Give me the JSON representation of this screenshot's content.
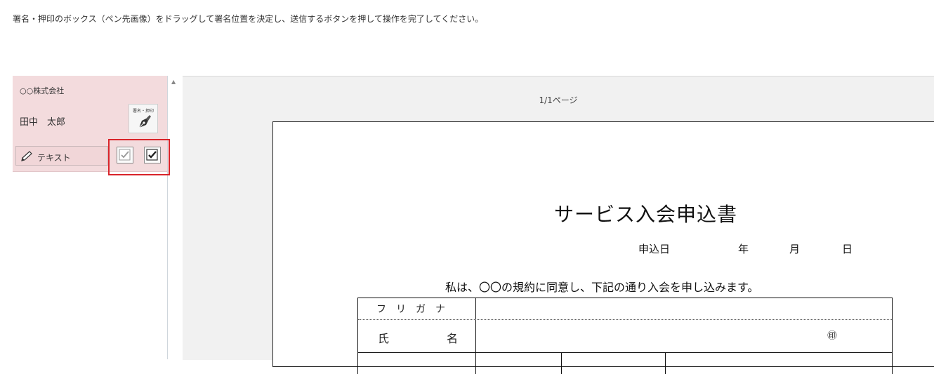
{
  "instruction": "署名・押印のボックス（ペン先画像）をドラッグして署名位置を決定し、送信するボタンを押して操作を完了してください。",
  "signer": {
    "company": "○○株式会社",
    "name": "田中　太郎",
    "sign_button_label": "署名・押印"
  },
  "tools": {
    "text_label": "テキスト"
  },
  "viewer": {
    "page_indicator": "1/1ページ"
  },
  "document": {
    "title": "サービス入会申込書",
    "date_label": "申込日",
    "year": "年",
    "month": "月",
    "day": "日",
    "agreement": "私は、〇〇の規約に同意し、下記の通り入会を申し込みます。",
    "rows": {
      "furigana": "フリガナ",
      "name_1": "氏",
      "name_2": "名",
      "seal": "㊞"
    }
  }
}
